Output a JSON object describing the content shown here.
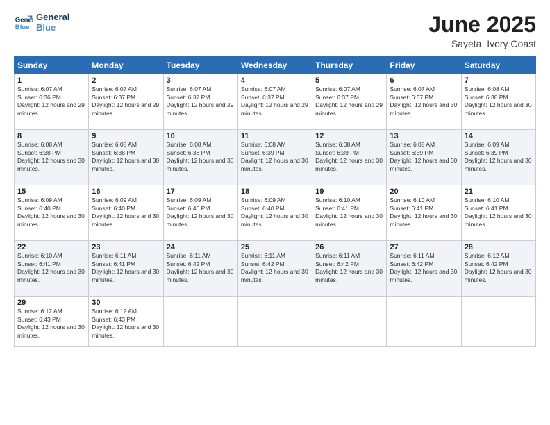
{
  "logo": {
    "line1": "General",
    "line2": "Blue"
  },
  "title": "June 2025",
  "subtitle": "Sayeta, Ivory Coast",
  "days_header": [
    "Sunday",
    "Monday",
    "Tuesday",
    "Wednesday",
    "Thursday",
    "Friday",
    "Saturday"
  ],
  "weeks": [
    [
      {
        "day": "1",
        "sunrise": "6:07 AM",
        "sunset": "6:36 PM",
        "daylight": "12 hours and 29 minutes."
      },
      {
        "day": "2",
        "sunrise": "6:07 AM",
        "sunset": "6:37 PM",
        "daylight": "12 hours and 29 minutes."
      },
      {
        "day": "3",
        "sunrise": "6:07 AM",
        "sunset": "6:37 PM",
        "daylight": "12 hours and 29 minutes."
      },
      {
        "day": "4",
        "sunrise": "6:07 AM",
        "sunset": "6:37 PM",
        "daylight": "12 hours and 29 minutes."
      },
      {
        "day": "5",
        "sunrise": "6:07 AM",
        "sunset": "6:37 PM",
        "daylight": "12 hours and 29 minutes."
      },
      {
        "day": "6",
        "sunrise": "6:07 AM",
        "sunset": "6:37 PM",
        "daylight": "12 hours and 30 minutes."
      },
      {
        "day": "7",
        "sunrise": "6:08 AM",
        "sunset": "6:38 PM",
        "daylight": "12 hours and 30 minutes."
      }
    ],
    [
      {
        "day": "8",
        "sunrise": "6:08 AM",
        "sunset": "6:38 PM",
        "daylight": "12 hours and 30 minutes."
      },
      {
        "day": "9",
        "sunrise": "6:08 AM",
        "sunset": "6:38 PM",
        "daylight": "12 hours and 30 minutes."
      },
      {
        "day": "10",
        "sunrise": "6:08 AM",
        "sunset": "6:38 PM",
        "daylight": "12 hours and 30 minutes."
      },
      {
        "day": "11",
        "sunrise": "6:08 AM",
        "sunset": "6:39 PM",
        "daylight": "12 hours and 30 minutes."
      },
      {
        "day": "12",
        "sunrise": "6:08 AM",
        "sunset": "6:39 PM",
        "daylight": "12 hours and 30 minutes."
      },
      {
        "day": "13",
        "sunrise": "6:08 AM",
        "sunset": "6:39 PM",
        "daylight": "12 hours and 30 minutes."
      },
      {
        "day": "14",
        "sunrise": "6:09 AM",
        "sunset": "6:39 PM",
        "daylight": "12 hours and 30 minutes."
      }
    ],
    [
      {
        "day": "15",
        "sunrise": "6:09 AM",
        "sunset": "6:40 PM",
        "daylight": "12 hours and 30 minutes."
      },
      {
        "day": "16",
        "sunrise": "6:09 AM",
        "sunset": "6:40 PM",
        "daylight": "12 hours and 30 minutes."
      },
      {
        "day": "17",
        "sunrise": "6:09 AM",
        "sunset": "6:40 PM",
        "daylight": "12 hours and 30 minutes."
      },
      {
        "day": "18",
        "sunrise": "6:09 AM",
        "sunset": "6:40 PM",
        "daylight": "12 hours and 30 minutes."
      },
      {
        "day": "19",
        "sunrise": "6:10 AM",
        "sunset": "6:41 PM",
        "daylight": "12 hours and 30 minutes."
      },
      {
        "day": "20",
        "sunrise": "6:10 AM",
        "sunset": "6:41 PM",
        "daylight": "12 hours and 30 minutes."
      },
      {
        "day": "21",
        "sunrise": "6:10 AM",
        "sunset": "6:41 PM",
        "daylight": "12 hours and 30 minutes."
      }
    ],
    [
      {
        "day": "22",
        "sunrise": "6:10 AM",
        "sunset": "6:41 PM",
        "daylight": "12 hours and 30 minutes."
      },
      {
        "day": "23",
        "sunrise": "6:11 AM",
        "sunset": "6:41 PM",
        "daylight": "12 hours and 30 minutes."
      },
      {
        "day": "24",
        "sunrise": "6:11 AM",
        "sunset": "6:42 PM",
        "daylight": "12 hours and 30 minutes."
      },
      {
        "day": "25",
        "sunrise": "6:11 AM",
        "sunset": "6:42 PM",
        "daylight": "12 hours and 30 minutes."
      },
      {
        "day": "26",
        "sunrise": "6:11 AM",
        "sunset": "6:42 PM",
        "daylight": "12 hours and 30 minutes."
      },
      {
        "day": "27",
        "sunrise": "6:11 AM",
        "sunset": "6:42 PM",
        "daylight": "12 hours and 30 minutes."
      },
      {
        "day": "28",
        "sunrise": "6:12 AM",
        "sunset": "6:42 PM",
        "daylight": "12 hours and 30 minutes."
      }
    ],
    [
      {
        "day": "29",
        "sunrise": "6:12 AM",
        "sunset": "6:43 PM",
        "daylight": "12 hours and 30 minutes."
      },
      {
        "day": "30",
        "sunrise": "6:12 AM",
        "sunset": "6:43 PM",
        "daylight": "12 hours and 30 minutes."
      },
      null,
      null,
      null,
      null,
      null
    ]
  ]
}
